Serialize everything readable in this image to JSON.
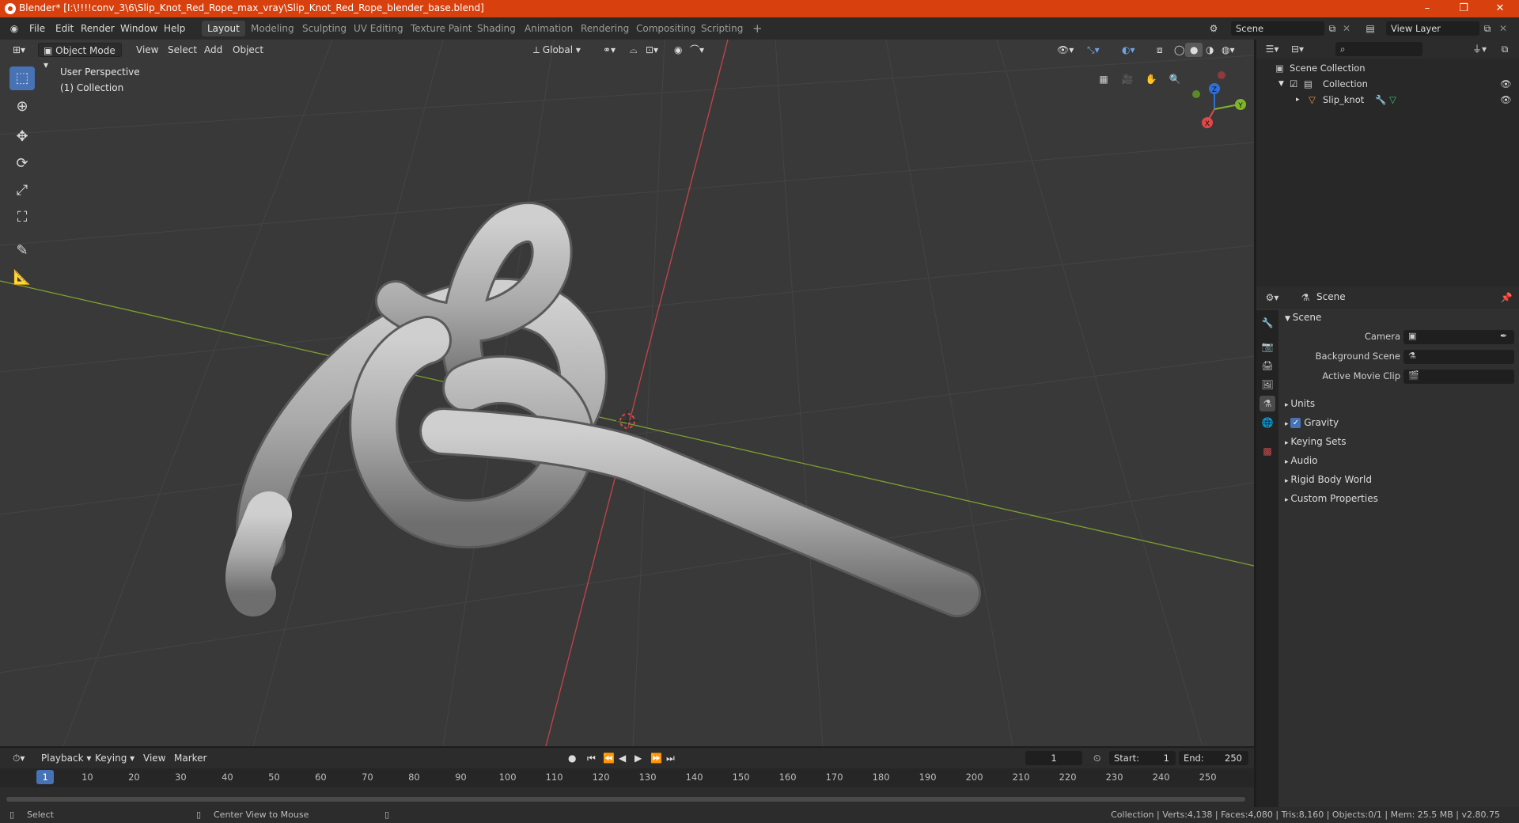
{
  "window": {
    "title": "Blender* [I:\\!!!!conv_3\\6\\Slip_Knot_Red_Rope_max_vray\\Slip_Knot_Red_Rope_blender_base.blend]",
    "minimize": "–",
    "restore": "❐",
    "close": "✕"
  },
  "menu": [
    "File",
    "Edit",
    "Render",
    "Window",
    "Help"
  ],
  "workspaces": [
    "Layout",
    "Modeling",
    "Sculpting",
    "UV Editing",
    "Texture Paint",
    "Shading",
    "Animation",
    "Rendering",
    "Compositing",
    "Scripting"
  ],
  "workspace_add": "+",
  "scene_field": "Scene",
  "view_layer_field": "View Layer",
  "viewport": {
    "mode": "Object Mode",
    "menus": [
      "View",
      "Select",
      "Add",
      "Object"
    ],
    "transform_orientation": "Global",
    "perspective_label": "User Perspective",
    "collection_label": "(1) Collection",
    "gizmo": {
      "z": "Z",
      "y": "Y",
      "x": "X"
    }
  },
  "outliner": {
    "root": "Scene Collection",
    "collection": "Collection",
    "object": "Slip_knot"
  },
  "properties": {
    "header": "Scene",
    "panel": "Scene",
    "camera_label": "Camera",
    "background_scene_label": "Background Scene",
    "movie_clip_label": "Active Movie Clip",
    "sections": [
      "Units",
      "Gravity",
      "Keying Sets",
      "Audio",
      "Rigid Body World",
      "Custom Properties"
    ],
    "gravity_checked": true
  },
  "timeline": {
    "menus": [
      "Playback",
      "Keying",
      "View",
      "Marker"
    ],
    "current_frame": "1",
    "start_label": "Start:",
    "start": "1",
    "end_label": "End:",
    "end": "250",
    "ruler": [
      "1",
      "10",
      "20",
      "30",
      "40",
      "50",
      "60",
      "70",
      "80",
      "90",
      "100",
      "110",
      "120",
      "130",
      "140",
      "150",
      "160",
      "170",
      "180",
      "190",
      "200",
      "210",
      "220",
      "230",
      "240",
      "250"
    ]
  },
  "status": {
    "left_action": "Select",
    "middle_action": "Center View to Mouse",
    "stats": "Collection | Verts:4,138 | Faces:4,080 | Tris:8,160 | Objects:0/1 | Mem: 25.5 MB | v2.80.75"
  },
  "colors": {
    "accent": "#4772b3",
    "titlebar": "#d8400d",
    "viewport_bg": "#393939",
    "x_axis": "#c4444c",
    "y_axis": "#7ea12e"
  }
}
